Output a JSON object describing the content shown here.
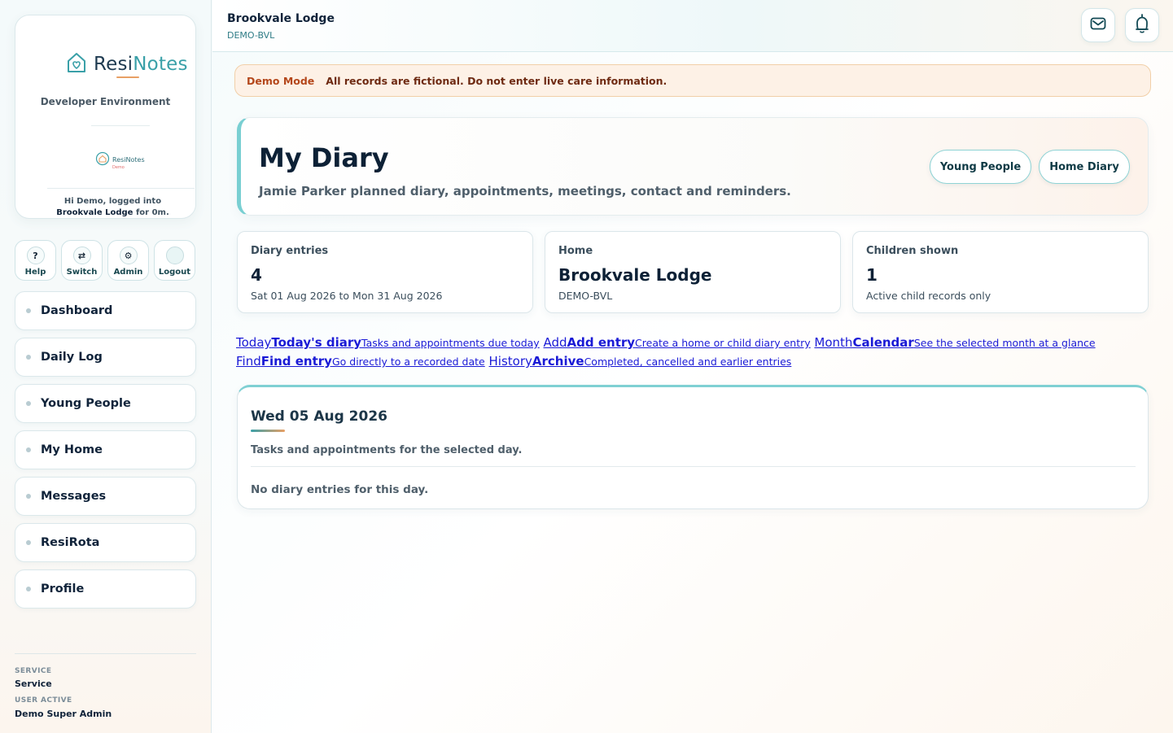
{
  "brand": {
    "name_part1": "Resi",
    "name_part2": "Notes",
    "environment": "Developer Environment",
    "mini_logo_text": "ResiNotes",
    "mini_logo_sub": "Demo",
    "login_prefix": "Hi Demo, logged into ",
    "login_home": "Brookvale Lodge",
    "login_suffix": " for 0m."
  },
  "quick_actions": [
    {
      "label": "Help",
      "icon": "?"
    },
    {
      "label": "Switch",
      "icon": "⇄"
    },
    {
      "label": "Admin",
      "icon": "⚙"
    },
    {
      "label": "Logout",
      "icon": ""
    }
  ],
  "nav": [
    {
      "label": "Dashboard"
    },
    {
      "label": "Daily Log"
    },
    {
      "label": "Young People"
    },
    {
      "label": "My Home"
    },
    {
      "label": "Messages"
    },
    {
      "label": "ResiRota"
    },
    {
      "label": "Profile"
    }
  ],
  "footer": {
    "service_caption": "SERVICE",
    "service_value": "Service",
    "user_caption": "USER ACTIVE",
    "user_value": "Demo Super Admin"
  },
  "topbar": {
    "home_name": "Brookvale Lodge",
    "home_code": "DEMO-BVL",
    "icons": [
      "mail-icon",
      "bell-icon"
    ]
  },
  "demo_banner": {
    "tag": "Demo Mode",
    "message": "All records are fictional. Do not enter live care information."
  },
  "hero": {
    "title": "My Diary",
    "subtitle": "Jamie Parker planned diary, appointments, meetings, contact and reminders.",
    "buttons": [
      "Young People",
      "Home Diary"
    ]
  },
  "stats": [
    {
      "caption": "Diary entries",
      "value": "4",
      "note": "Sat 01 Aug 2026 to Mon 31 Aug 2026"
    },
    {
      "caption": "Home",
      "value": "Brookvale Lodge",
      "note": "DEMO-BVL"
    },
    {
      "caption": "Children shown",
      "value": "1",
      "note": "Active child records only"
    }
  ],
  "quick_links": [
    {
      "word": "Today",
      "title": "Today's diary",
      "desc": "Tasks and appointments due today"
    },
    {
      "word": "Add",
      "title": "Add entry",
      "desc": "Create a home or child diary entry"
    },
    {
      "word": "Month",
      "title": "Calendar",
      "desc": "See the selected month at a glance"
    },
    {
      "word": "Find",
      "title": "Find entry",
      "desc": "Go directly to a recorded date"
    },
    {
      "word": "History",
      "title": "Archive",
      "desc": "Completed, cancelled and earlier entries"
    }
  ],
  "day_panel": {
    "date": "Wed 05 Aug 2026",
    "subtitle": "Tasks and appointments for the selected day.",
    "empty_message": "No diary entries for this day."
  },
  "colors": {
    "accent_teal": "#3aa0a8",
    "accent_orange": "#e8a065",
    "demo_text": "#b4471b",
    "link_blue": "#1a1ad6"
  }
}
